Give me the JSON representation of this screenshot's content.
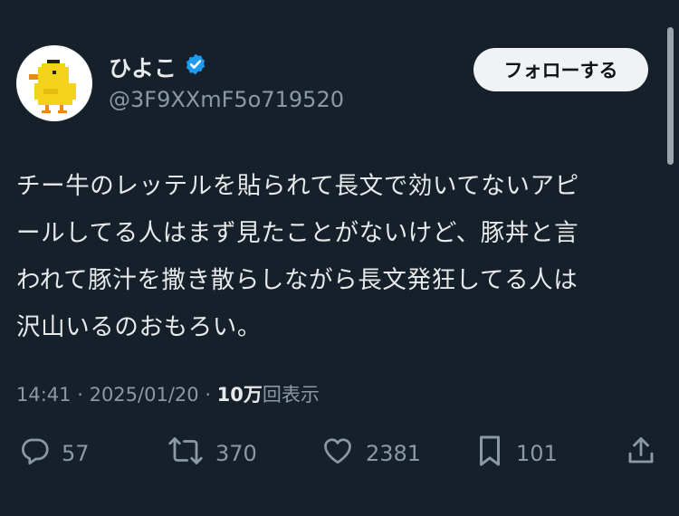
{
  "user": {
    "display_name": "ひよこ",
    "handle": "@3F9XXmF5o719520",
    "verified_color": "#1d9bf0"
  },
  "follow_button": {
    "label": "フォローする"
  },
  "tweet": {
    "lines": [
      "チー牛のレッテルを貼られて長文で効いてないアピ",
      "ールしてる人はまず見たことがないけど、豚丼と言",
      "われて豚汁を撒き散らしながら長文発狂してる人は",
      "沢山いるのおもろい。"
    ]
  },
  "meta": {
    "time": "14:41",
    "date": "2025/01/20",
    "views_count": "10万",
    "views_label": "回表示"
  },
  "actions": {
    "replies": "57",
    "retweets": "370",
    "likes": "2381",
    "bookmarks": "101"
  },
  "colors": {
    "background": "#15202b",
    "text": "#e7e9ea",
    "secondary": "#8b98a5"
  }
}
